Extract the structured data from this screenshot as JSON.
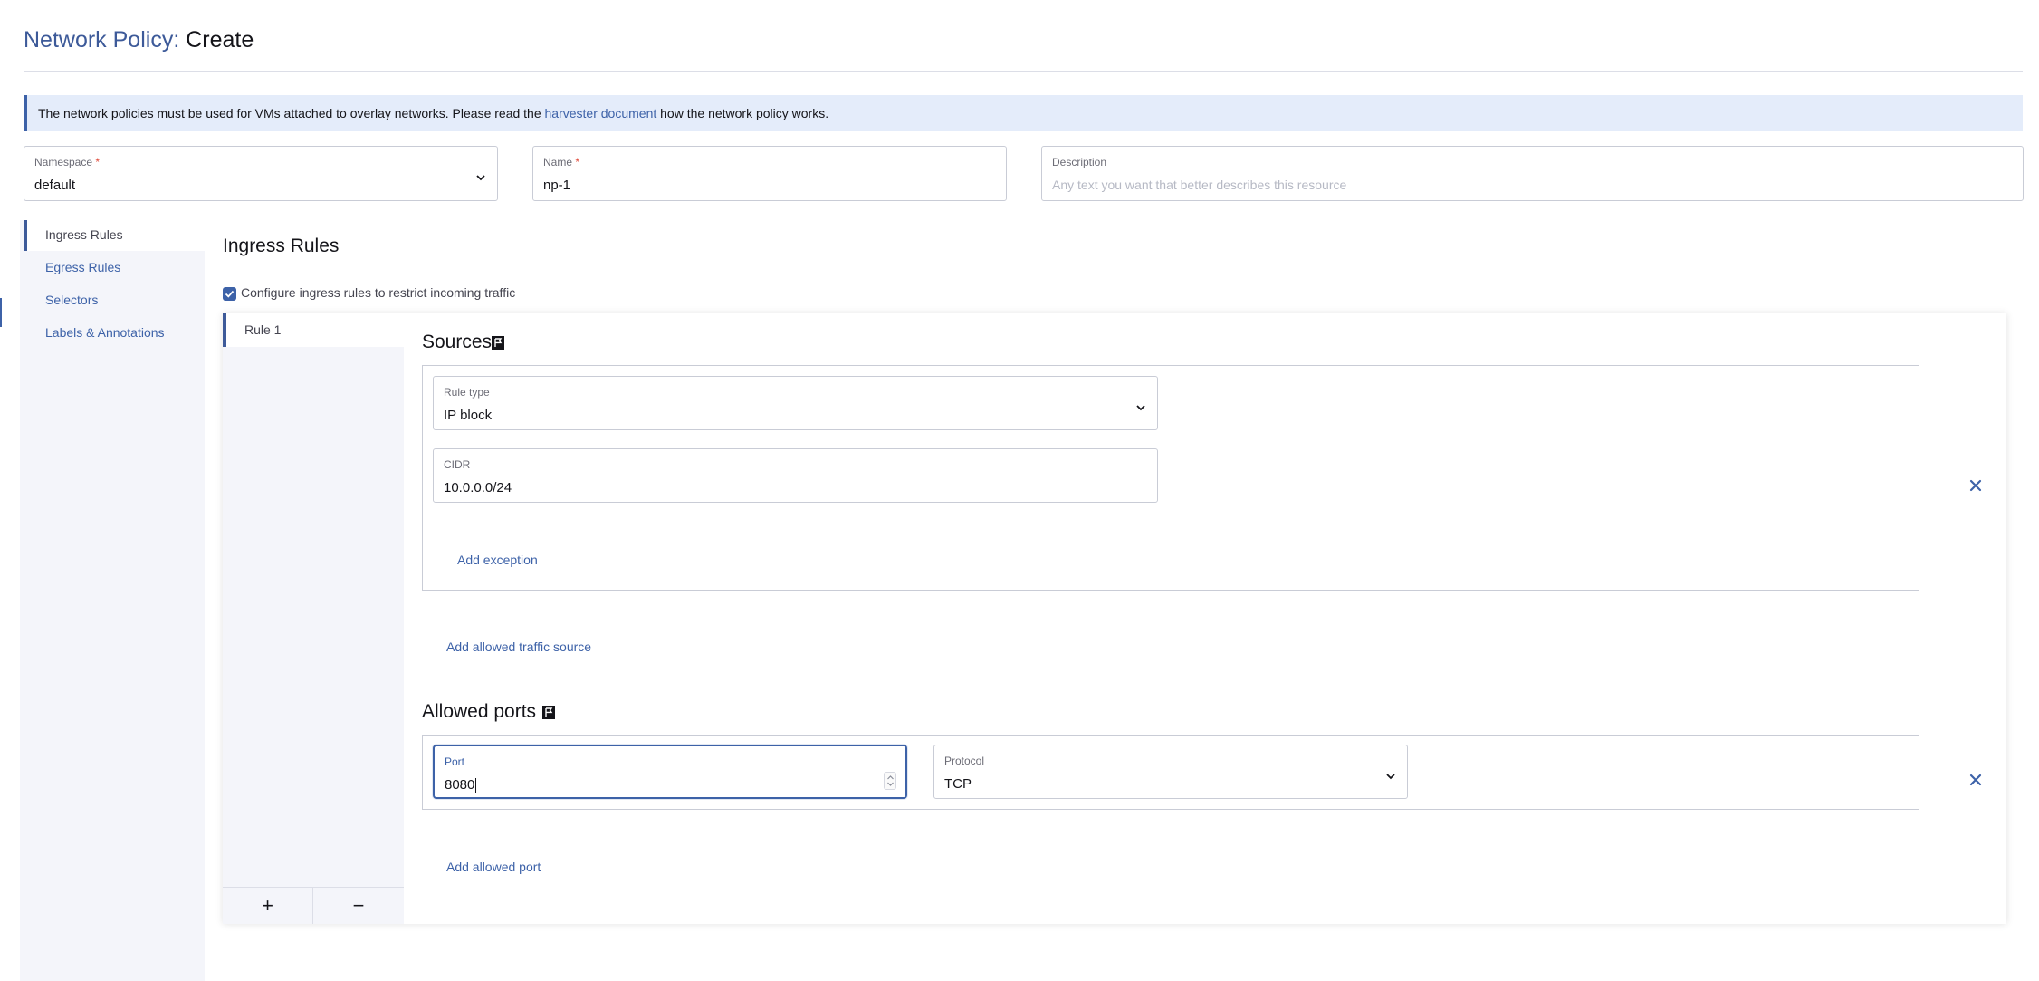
{
  "header": {
    "title_prefix": "Network Policy:",
    "title_suffix": "Create"
  },
  "banner": {
    "text_before": "The network policies must be used for VMs attached to overlay networks. Please read the",
    "link_text": "harvester document",
    "text_after": "how the network policy works."
  },
  "fields": {
    "namespace": {
      "label": "Namespace",
      "required_mark": "*",
      "value": "default"
    },
    "name": {
      "label": "Name",
      "required_mark": "*",
      "value": "np-1"
    },
    "description": {
      "label": "Description",
      "placeholder": "Any text you want that better describes this resource"
    }
  },
  "sidenav": {
    "items": [
      {
        "label": "Ingress Rules",
        "active": true
      },
      {
        "label": "Egress Rules",
        "active": false
      },
      {
        "label": "Selectors",
        "active": false
      },
      {
        "label": "Labels & Annotations",
        "active": false
      }
    ]
  },
  "main": {
    "section_title": "Ingress Rules",
    "checkbox_label": "Configure ingress rules to restrict incoming traffic",
    "checkbox_checked": true,
    "rules": [
      {
        "label": "Rule 1"
      }
    ],
    "add_rule": "+",
    "remove_rule": "−",
    "sources": {
      "title": "Sources",
      "rule_type": {
        "label": "Rule type",
        "value": "IP block"
      },
      "cidr": {
        "label": "CIDR",
        "value": "10.0.0.0/24"
      },
      "add_exception": "Add exception",
      "add_source": "Add allowed traffic source"
    },
    "ports": {
      "title": "Allowed ports",
      "port": {
        "label": "Port",
        "value": "8080"
      },
      "protocol": {
        "label": "Protocol",
        "value": "TCP"
      },
      "add_port": "Add allowed port"
    }
  },
  "colors": {
    "accent": "#3d62a8",
    "title_blue": "#3d5a99",
    "banner_bg": "#e4ecfa"
  }
}
